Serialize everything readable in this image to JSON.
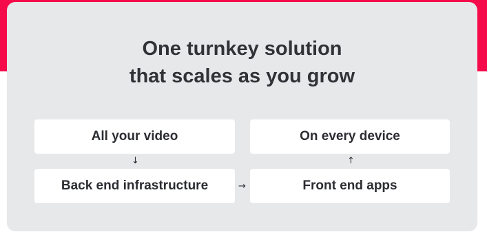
{
  "headline": {
    "line1": "One turnkey solution",
    "line2": "that scales as you grow"
  },
  "boxes": {
    "video": "All your video",
    "device": "On every device",
    "backend": "Back end infrastructure",
    "frontend": "Front end apps"
  },
  "arrows": {
    "down": "↓",
    "up": "↑",
    "right": "→"
  },
  "colors": {
    "accent": "#f50b4a",
    "card": "#e7e8ea",
    "box": "#ffffff",
    "text": "#2b2d31"
  }
}
